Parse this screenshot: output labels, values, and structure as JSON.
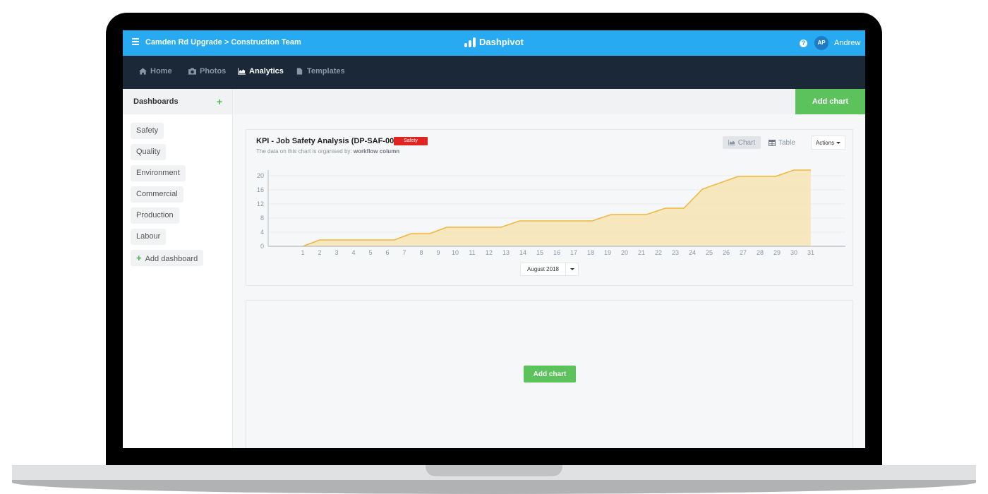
{
  "header": {
    "breadcrumb": "Camden Rd Upgrade > Construction Team",
    "brand": "Dashpivot",
    "avatar_initials": "AP",
    "username": "Andrew",
    "help_icon": "?",
    "brand_color": "#28aaf3"
  },
  "nav": {
    "items": [
      {
        "label": "Home",
        "icon": "home-icon",
        "active": false
      },
      {
        "label": "Photos",
        "icon": "camera-icon",
        "active": false
      },
      {
        "label": "Analytics",
        "icon": "area-chart-icon",
        "active": true
      },
      {
        "label": "Templates",
        "icon": "file-icon",
        "active": false
      }
    ]
  },
  "sidebar": {
    "title": "Dashboards",
    "add_symbol": "+",
    "items": [
      "Safety",
      "Quality",
      "Environment",
      "Commercial",
      "Production",
      "Labour"
    ],
    "add_label": "Add dashboard"
  },
  "content": {
    "add_chart_label": "Add chart",
    "empty_add_chart_label": "Add chart"
  },
  "chart_card": {
    "title": "KPI - Job Safety Analysis (DP-SAF-0013)",
    "badge": "Safety",
    "badge_color": "#e02424",
    "subtitle_prefix": "The data on this chart is organised by: ",
    "subtitle_value": "workflow column",
    "view_chart_label": "Chart",
    "view_table_label": "Table",
    "actions_label": "Actions",
    "month_selected": "August 2018"
  },
  "chart_data": {
    "type": "area",
    "title": "KPI - Job Safety Analysis (DP-SAF-0013)",
    "xlabel": "",
    "ylabel": "",
    "x_ticks": [
      "1",
      "2",
      "3",
      "4",
      "5",
      "6",
      "7",
      "8",
      "9",
      "10",
      "11",
      "12",
      "13",
      "14",
      "15",
      "16",
      "17",
      "18",
      "19",
      "20",
      "21",
      "22",
      "23",
      "24",
      "25",
      "26",
      "27",
      "28",
      "29",
      "30",
      "31"
    ],
    "y_ticks": [
      0,
      4,
      8,
      12,
      16,
      20
    ],
    "ylim": [
      0,
      20
    ],
    "grid": true,
    "legend": "none",
    "series": [
      {
        "name": "Job Safety Analysis",
        "color": "#f0b73a",
        "fill": "#f7e4b7",
        "points": [
          {
            "x": 1,
            "y": 0
          },
          {
            "x": 2,
            "y": 1.8
          },
          {
            "x": 6.4,
            "y": 1.8
          },
          {
            "x": 7.4,
            "y": 3.6
          },
          {
            "x": 8.5,
            "y": 3.6
          },
          {
            "x": 9.5,
            "y": 5.4
          },
          {
            "x": 12.7,
            "y": 5.4
          },
          {
            "x": 13.8,
            "y": 7.2
          },
          {
            "x": 18.1,
            "y": 7.2
          },
          {
            "x": 19.2,
            "y": 9
          },
          {
            "x": 21.3,
            "y": 9
          },
          {
            "x": 22.4,
            "y": 10.8
          },
          {
            "x": 23.5,
            "y": 10.8
          },
          {
            "x": 24.6,
            "y": 16.2
          },
          {
            "x": 26.7,
            "y": 19.8
          },
          {
            "x": 28.9,
            "y": 19.8
          },
          {
            "x": 30,
            "y": 21.6
          },
          {
            "x": 31,
            "y": 21.6
          }
        ]
      }
    ]
  }
}
